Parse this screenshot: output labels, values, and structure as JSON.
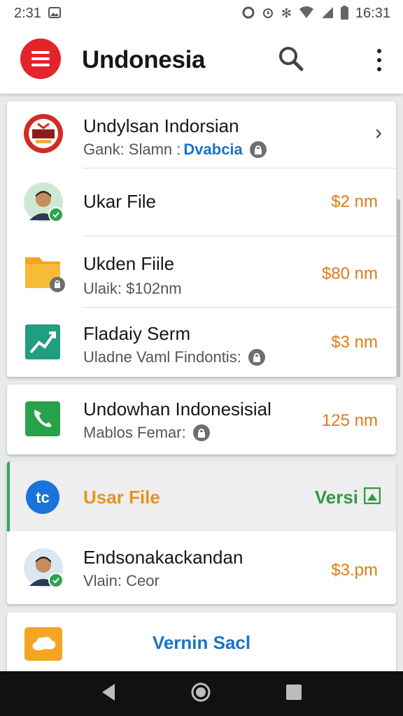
{
  "status_bar": {
    "time_left": "2:31",
    "time_right": "16:31"
  },
  "app_bar": {
    "title": "Undonesia",
    "menu_icon": "menu-icon",
    "search_icon": "search-icon",
    "more_icon": "more-vert-icon"
  },
  "colors": {
    "accent_red": "#e4232a",
    "price_orange": "#e07b16",
    "link_blue": "#1a73c9",
    "green": "#34a853"
  },
  "card1": {
    "rows": [
      {
        "title": "Undylsan Indorsian",
        "sub_prefix": "Gank: Slamn :",
        "sub_highlight": "Dvabcia",
        "icon": "crest-icon"
      },
      {
        "title": "Ukar File",
        "price": "$2 nm",
        "icon": "avatar"
      },
      {
        "title": "Ukden Fiile",
        "sub": "Ulaik: $102nm",
        "price": "$80 nm",
        "icon": "folder-icon"
      },
      {
        "title": "Fladaiy Serm",
        "sub": "Uladne Vaml Findontis:",
        "price": "$3 nm",
        "icon": "trend-chart-icon"
      }
    ]
  },
  "card2": {
    "title": "Undowhan Indonesisial",
    "sub": "Mablos Femar:",
    "price": "125 nm",
    "icon": "phone-icon"
  },
  "card3": {
    "highlight_row": {
      "title": "Usar File",
      "action": "Versi",
      "icon": "tc-logo-icon"
    },
    "row": {
      "title": "Endsonakackandan",
      "sub": "Vlain: Ceor",
      "price": "$3.pm",
      "icon": "avatar"
    }
  },
  "card4": {
    "label": "Vernin Sacl",
    "icon": "cloud-icon"
  }
}
